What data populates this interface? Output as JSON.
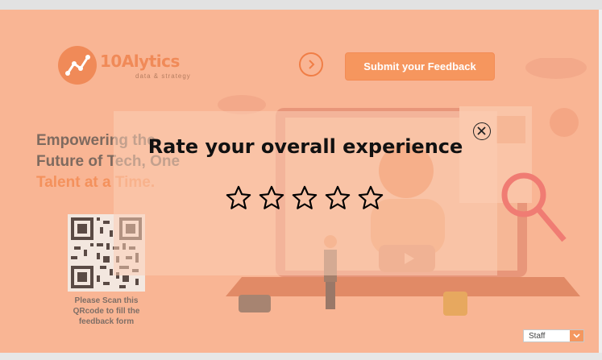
{
  "brand": {
    "name": "10Alytics",
    "tagline": "data & strategy",
    "accent": "#f08a58",
    "background": "#f9b594"
  },
  "header": {
    "next_icon": "chevron-right-circle-icon",
    "submit_label": "Submit your Feedback"
  },
  "hero": {
    "line1": "Empowering the",
    "line2": "Future of Tech, One",
    "line3": "Talent at a Time."
  },
  "qr": {
    "caption": "Please Scan this QRcode  to fill the feedback form"
  },
  "modal": {
    "title": "Rate your overall experience",
    "close_icon": "close-circle-icon",
    "rating": {
      "selected": 0,
      "max": 5
    }
  },
  "role_select": {
    "value": "Staff"
  }
}
